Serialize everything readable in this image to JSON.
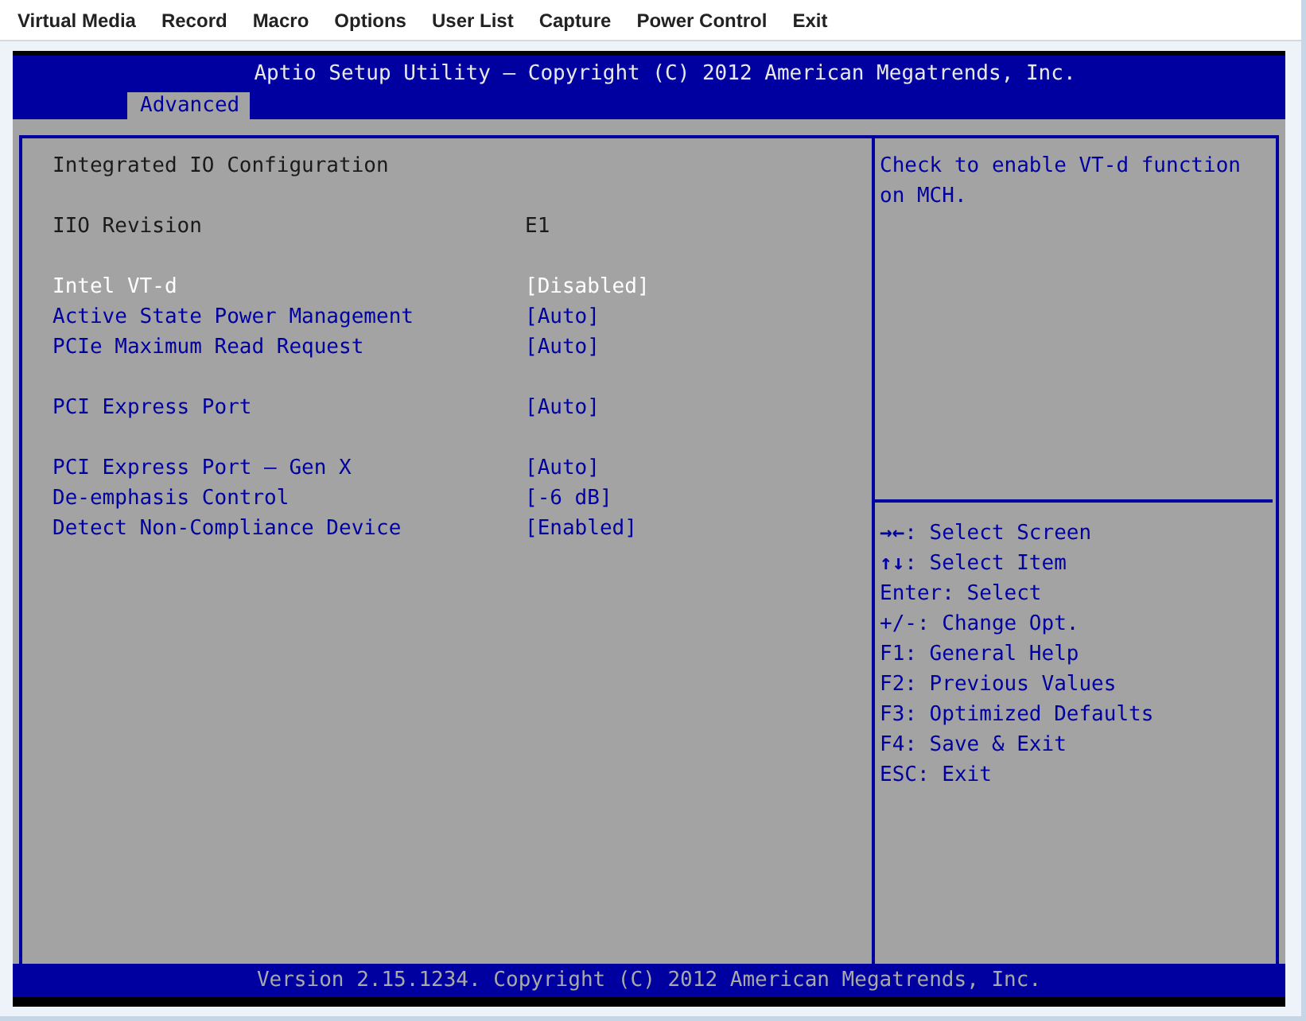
{
  "menu_bar": [
    "Virtual Media",
    "Record",
    "Macro",
    "Options",
    "User List",
    "Capture",
    "Power Control",
    "Exit"
  ],
  "header": {
    "title": "Aptio Setup Utility – Copyright (C) 2012 American Megatrends, Inc.",
    "tabs": [
      {
        "label": "Advanced",
        "selected": true
      }
    ]
  },
  "groups": [
    [
      {
        "kind": "title",
        "label": "Integrated IO Configuration"
      }
    ],
    [
      {
        "kind": "info",
        "label": "IIO Revision",
        "value": "E1"
      }
    ],
    [
      {
        "kind": "option",
        "label": "Intel VT-d",
        "value": "[Disabled]",
        "selected": true
      },
      {
        "kind": "option",
        "label": "Active State Power Management",
        "value": "[Auto]",
        "selected": false
      },
      {
        "kind": "option",
        "label": "PCIe Maximum Read Request",
        "value": "[Auto]",
        "selected": false
      }
    ],
    [
      {
        "kind": "option",
        "label": "PCI Express Port",
        "value": "[Auto]",
        "selected": false
      }
    ],
    [
      {
        "kind": "option",
        "label": "PCI Express Port – Gen X",
        "value": "[Auto]",
        "selected": false
      },
      {
        "kind": "option",
        "label": "De-emphasis Control",
        "value": "[-6 dB]",
        "selected": false
      },
      {
        "kind": "option",
        "label": "Detect Non-Compliance Device",
        "value": "[Enabled]",
        "selected": false
      }
    ]
  ],
  "help_text": "Check to enable VT-d function on MCH.",
  "key_help": [
    "**→←**: Select Screen",
    "**↑↓**: Select Item",
    "Enter: Select",
    "+/-: Change Opt.",
    "F1: General Help",
    "F2: Previous Values",
    "F3: Optimized Defaults",
    "F4: Save & Exit",
    "ESC: Exit"
  ],
  "footer": "Version 2.15.1234. Copyright (C) 2012 American Megatrends, Inc."
}
